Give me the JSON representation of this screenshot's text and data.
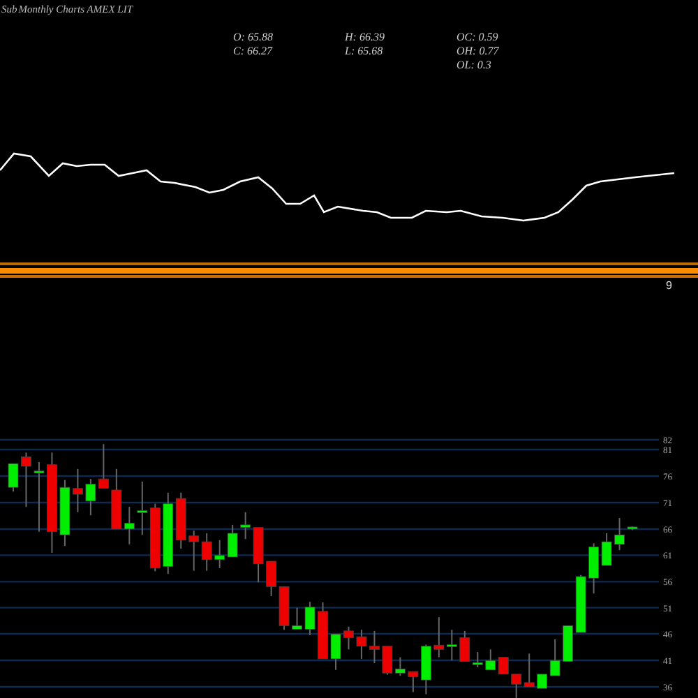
{
  "header": {
    "prefix": "Sub",
    "title": "Monthly Charts AMEX  LIT"
  },
  "stats": [
    {
      "lines": [
        "O: 65.88",
        "C: 66.27"
      ]
    },
    {
      "lines": [
        "H: 66.39",
        "L: 65.68"
      ]
    },
    {
      "lines": [
        "OC: 0.59",
        "OH: 0.77",
        "OL: 0.3"
      ]
    }
  ],
  "band": {
    "label": "9"
  },
  "price_chart": {
    "axis_labels": [
      "82",
      "81",
      "76",
      "71",
      "66",
      "61",
      "56",
      "51",
      "46",
      "41",
      "36"
    ]
  }
}
